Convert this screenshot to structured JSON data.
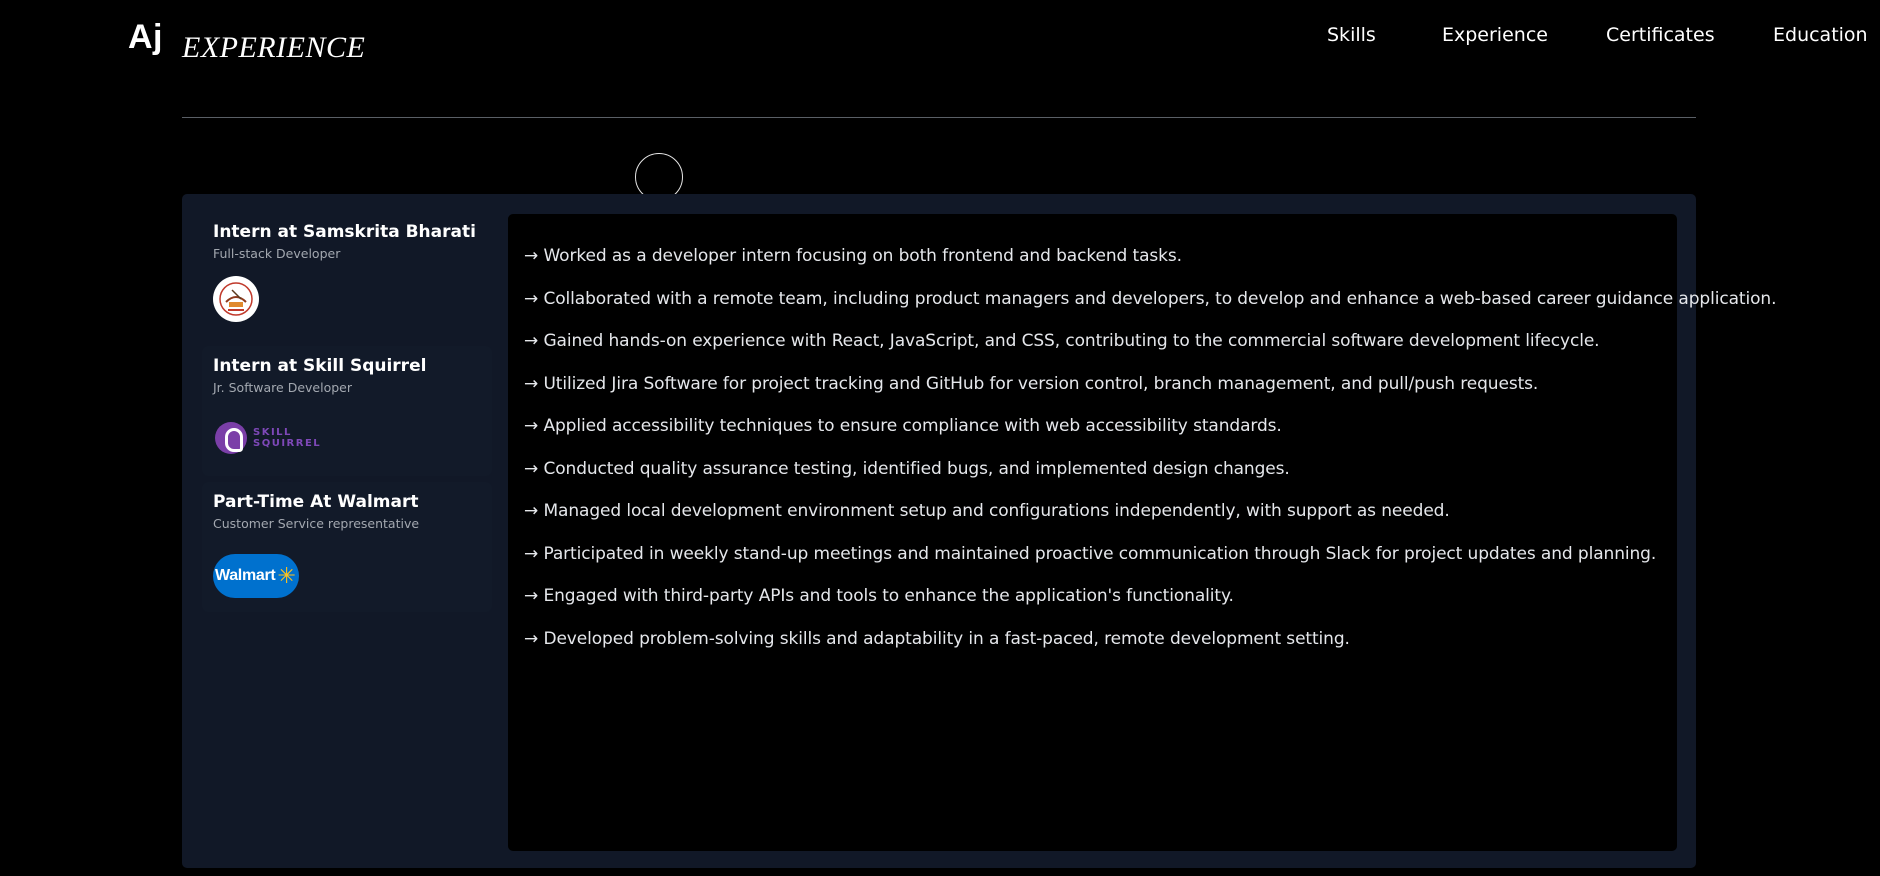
{
  "header": {
    "logo": "Aj",
    "section_title": "EXPERIENCE",
    "nav": [
      "Skills",
      "Experience",
      "Certificates",
      "Education"
    ]
  },
  "jobs": [
    {
      "title": "Intern at Samskrita Bharati",
      "role": "Full-stack Developer",
      "logo_icon": "samskrita-bharati-logo"
    },
    {
      "title": "Intern at Skill Squirrel",
      "role": "Jr. Software Developer",
      "logo_icon": "skill-squirrel-logo",
      "logo_text": [
        "SKILL",
        "SQUIRREL"
      ]
    },
    {
      "title": "Part-Time At Walmart",
      "role": "Customer Service representative",
      "logo_icon": "walmart-logo",
      "logo_text": "Walmart"
    }
  ],
  "details": [
    "→ Worked as a developer intern focusing on both frontend and backend tasks.",
    "→ Collaborated with a remote team, including product managers and developers, to develop and enhance a web-based career guidance application.",
    "→ Gained hands-on experience with React, JavaScript, and CSS, contributing to the commercial software development lifecycle.",
    "→ Utilized Jira Software for project tracking and GitHub for version control, branch management, and pull/push requests.",
    "→ Applied accessibility techniques to ensure compliance with web accessibility standards.",
    "→ Conducted quality assurance testing, identified bugs, and implemented design changes.",
    "→ Managed local development environment setup and configurations independently, with support as needed.",
    "→ Participated in weekly stand-up meetings and maintained proactive communication through Slack for project updates and planning.",
    "→ Engaged with third-party APIs and tools to enhance the application's functionality.",
    "→ Developed problem-solving skills and adaptability in a fast-paced, remote development setting."
  ],
  "colors": {
    "background": "#000000",
    "panel": "#111827",
    "walmart_blue": "#0071ce",
    "walmart_spark": "#ffc220",
    "squirrel_purple": "#7b3fa8"
  }
}
